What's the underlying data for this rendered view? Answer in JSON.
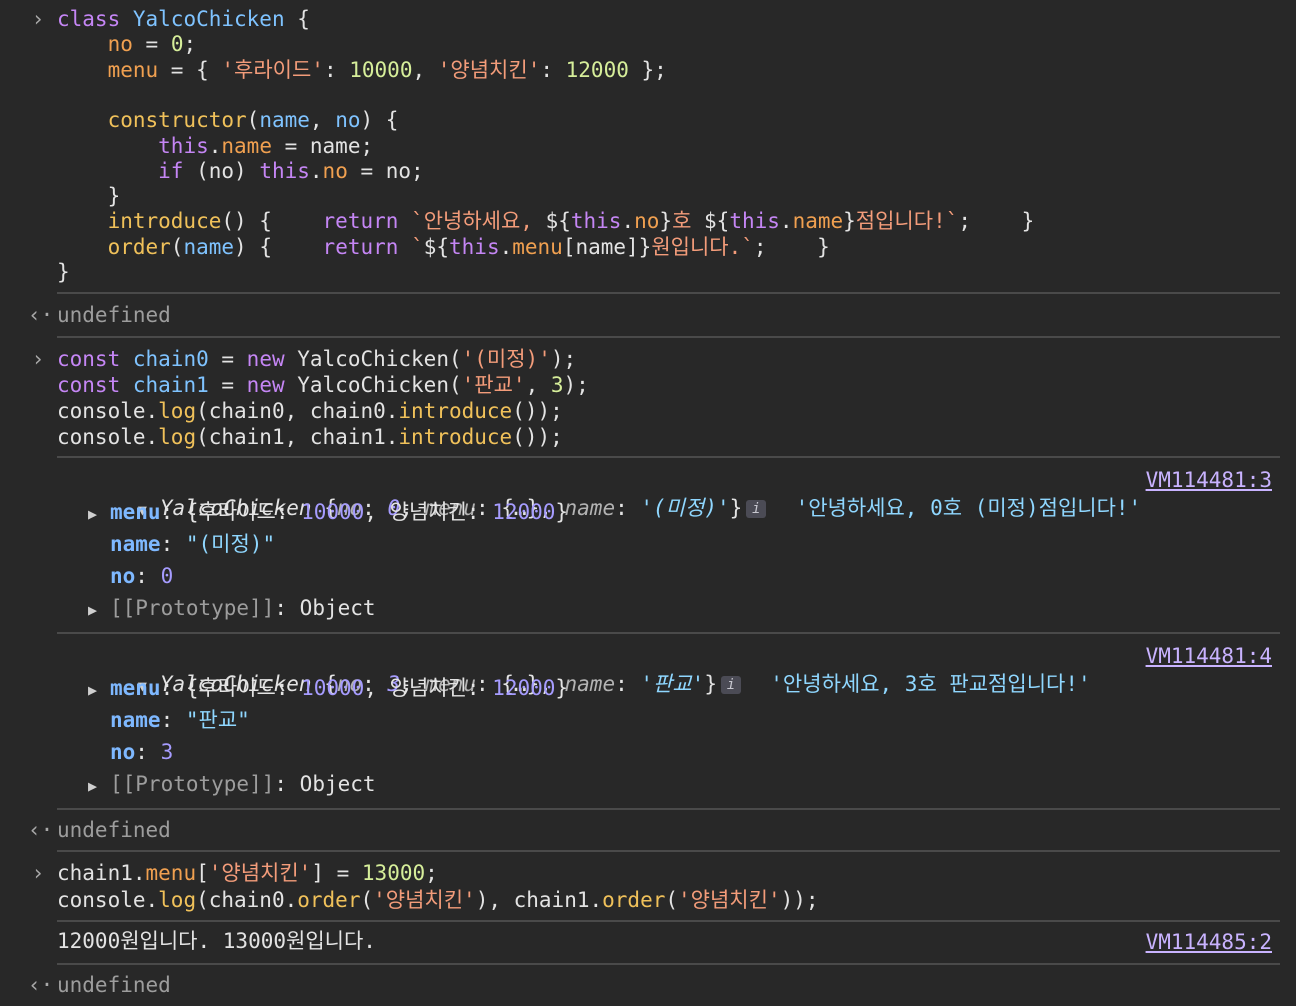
{
  "input1": {
    "lines": [
      [
        [
          "kw",
          "class"
        ],
        [
          "pl",
          " "
        ],
        [
          "cl",
          "YalcoChicken"
        ],
        [
          "pl",
          " {"
        ]
      ],
      [
        [
          "pl",
          "    "
        ],
        [
          "prm",
          "no"
        ],
        [
          "pl",
          " = "
        ],
        [
          "nm",
          "0"
        ],
        [
          "pl",
          ";"
        ]
      ],
      [
        [
          "pl",
          "    "
        ],
        [
          "prm",
          "menu"
        ],
        [
          "pl",
          " = { "
        ],
        [
          "st",
          "'후라이드'"
        ],
        [
          "pl",
          ": "
        ],
        [
          "nm",
          "10000"
        ],
        [
          "pl",
          ", "
        ],
        [
          "st",
          "'양념치킨'"
        ],
        [
          "pl",
          ": "
        ],
        [
          "nm",
          "12000"
        ],
        [
          "pl",
          " };"
        ]
      ],
      [
        [
          "pl",
          ""
        ]
      ],
      [
        [
          "pl",
          "    "
        ],
        [
          "fn",
          "constructor"
        ],
        [
          "pl",
          "("
        ],
        [
          "cl",
          "name"
        ],
        [
          "pl",
          ", "
        ],
        [
          "cl",
          "no"
        ],
        [
          "pl",
          ") {"
        ]
      ],
      [
        [
          "pl",
          "        "
        ],
        [
          "kw",
          "this"
        ],
        [
          "pl",
          "."
        ],
        [
          "prm",
          "name"
        ],
        [
          "pl",
          " = name;"
        ]
      ],
      [
        [
          "pl",
          "        "
        ],
        [
          "kw",
          "if"
        ],
        [
          "pl",
          " (no) "
        ],
        [
          "kw",
          "this"
        ],
        [
          "pl",
          "."
        ],
        [
          "prm",
          "no"
        ],
        [
          "pl",
          " = no;"
        ]
      ],
      [
        [
          "pl",
          "    }"
        ]
      ],
      [
        [
          "pl",
          "    "
        ],
        [
          "fn",
          "introduce"
        ],
        [
          "pl",
          "() {    "
        ],
        [
          "kw",
          "return"
        ],
        [
          "pl",
          " "
        ],
        [
          "st",
          "`안녕하세요, "
        ],
        [
          "pl",
          "${"
        ],
        [
          "kw",
          "this"
        ],
        [
          "pl",
          "."
        ],
        [
          "prm",
          "no"
        ],
        [
          "pl",
          "}"
        ],
        [
          "st",
          "호 "
        ],
        [
          "pl",
          "${"
        ],
        [
          "kw",
          "this"
        ],
        [
          "pl",
          "."
        ],
        [
          "prm",
          "name"
        ],
        [
          "pl",
          "}"
        ],
        [
          "st",
          "점입니다!`"
        ],
        [
          "pl",
          ";    }"
        ]
      ],
      [
        [
          "pl",
          "    "
        ],
        [
          "fn",
          "order"
        ],
        [
          "pl",
          "("
        ],
        [
          "cl",
          "name"
        ],
        [
          "pl",
          ") {    "
        ],
        [
          "kw",
          "return"
        ],
        [
          "pl",
          " "
        ],
        [
          "st",
          "`"
        ],
        [
          "pl",
          "${"
        ],
        [
          "kw",
          "this"
        ],
        [
          "pl",
          "."
        ],
        [
          "prm",
          "menu"
        ],
        [
          "pl",
          "[name]}"
        ],
        [
          "st",
          "원입니다.`"
        ],
        [
          "pl",
          ";    }"
        ]
      ],
      [
        [
          "pl",
          "}"
        ]
      ]
    ]
  },
  "result1": "undefined",
  "input2": {
    "lines": [
      [
        [
          "kw",
          "const"
        ],
        [
          "pl",
          " "
        ],
        [
          "cl",
          "chain0"
        ],
        [
          "pl",
          " = "
        ],
        [
          "kw",
          "new"
        ],
        [
          "pl",
          " YalcoChicken("
        ],
        [
          "st",
          "'(미정)'"
        ],
        [
          "pl",
          ");"
        ]
      ],
      [
        [
          "kw",
          "const"
        ],
        [
          "pl",
          " "
        ],
        [
          "cl",
          "chain1"
        ],
        [
          "pl",
          " = "
        ],
        [
          "kw",
          "new"
        ],
        [
          "pl",
          " YalcoChicken("
        ],
        [
          "st",
          "'판교'"
        ],
        [
          "pl",
          ", "
        ],
        [
          "nm",
          "3"
        ],
        [
          "pl",
          ");"
        ]
      ],
      [
        [
          "pl",
          "console."
        ],
        [
          "fn",
          "log"
        ],
        [
          "pl",
          "(chain0, chain0."
        ],
        [
          "fn",
          "introduce"
        ],
        [
          "pl",
          "());"
        ]
      ],
      [
        [
          "pl",
          "console."
        ],
        [
          "fn",
          "log"
        ],
        [
          "pl",
          "(chain1, chain1."
        ],
        [
          "fn",
          "introduce"
        ],
        [
          "pl",
          "());"
        ]
      ]
    ]
  },
  "log1": {
    "class_name": "YalcoChicken",
    "preview": [
      [
        "pl",
        " {"
      ],
      [
        "okey",
        "no"
      ],
      [
        "pl",
        ": "
      ],
      [
        "onum",
        "0"
      ],
      [
        "pl",
        ", "
      ],
      [
        "okey",
        "menu"
      ],
      [
        "pl",
        ": {…}, "
      ],
      [
        "okey",
        "name"
      ],
      [
        "pl",
        ": "
      ],
      [
        "ostr",
        "'(미정)'"
      ],
      [
        "pl",
        "}"
      ]
    ],
    "message": "'안녕하세요, 0호 (미정)점입니다!'",
    "source": "VM114481:3",
    "props": [
      {
        "key": "menu",
        "expandable": true,
        "value": [
          [
            "pl",
            "{"
          ],
          [
            "kor",
            "후라이드"
          ],
          [
            "pl",
            ": "
          ],
          [
            "pval-num",
            "10000"
          ],
          [
            "pl",
            ", "
          ],
          [
            "kor",
            "양념치킨"
          ],
          [
            "pl",
            ": "
          ],
          [
            "pval-num",
            "12000"
          ],
          [
            "pl",
            "}"
          ]
        ]
      },
      {
        "key": "name",
        "expandable": false,
        "value": [
          [
            "pval-str",
            "\"(미정)\""
          ]
        ]
      },
      {
        "key": "no",
        "expandable": false,
        "value": [
          [
            "pval-num",
            "0"
          ]
        ]
      },
      {
        "key": "[[Prototype]]",
        "expandable": true,
        "value": [
          [
            "pl",
            "Object"
          ]
        ]
      }
    ]
  },
  "log2": {
    "class_name": "YalcoChicken",
    "preview": [
      [
        "pl",
        " {"
      ],
      [
        "okey",
        "no"
      ],
      [
        "pl",
        ": "
      ],
      [
        "onum",
        "3"
      ],
      [
        "pl",
        ", "
      ],
      [
        "okey",
        "menu"
      ],
      [
        "pl",
        ": {…}, "
      ],
      [
        "okey",
        "name"
      ],
      [
        "pl",
        ": "
      ],
      [
        "ostr",
        "'판교'"
      ],
      [
        "pl",
        "}"
      ]
    ],
    "message": "'안녕하세요, 3호 판교점입니다!'",
    "source": "VM114481:4",
    "props": [
      {
        "key": "menu",
        "expandable": true,
        "value": [
          [
            "pl",
            "{"
          ],
          [
            "kor",
            "후라이드"
          ],
          [
            "pl",
            ": "
          ],
          [
            "pval-num",
            "10000"
          ],
          [
            "pl",
            ", "
          ],
          [
            "kor",
            "양념치킨"
          ],
          [
            "pl",
            ": "
          ],
          [
            "pval-num",
            "12000"
          ],
          [
            "pl",
            "}"
          ]
        ]
      },
      {
        "key": "name",
        "expandable": false,
        "value": [
          [
            "pval-str",
            "\"판교\""
          ]
        ]
      },
      {
        "key": "no",
        "expandable": false,
        "value": [
          [
            "pval-num",
            "3"
          ]
        ]
      },
      {
        "key": "[[Prototype]]",
        "expandable": true,
        "value": [
          [
            "pl",
            "Object"
          ]
        ]
      }
    ]
  },
  "result2": "undefined",
  "input3": {
    "lines": [
      [
        [
          "pl",
          "chain1."
        ],
        [
          "prm",
          "menu"
        ],
        [
          "pl",
          "["
        ],
        [
          "st",
          "'양념치킨'"
        ],
        [
          "pl",
          "] = "
        ],
        [
          "nm",
          "13000"
        ],
        [
          "pl",
          ";"
        ]
      ],
      [
        [
          "pl",
          "console."
        ],
        [
          "fn",
          "log"
        ],
        [
          "pl",
          "(chain0."
        ],
        [
          "fn",
          "order"
        ],
        [
          "pl",
          "("
        ],
        [
          "st",
          "'양념치킨'"
        ],
        [
          "pl",
          "), chain1."
        ],
        [
          "fn",
          "order"
        ],
        [
          "pl",
          "("
        ],
        [
          "st",
          "'양념치킨'"
        ],
        [
          "pl",
          "));"
        ]
      ]
    ]
  },
  "log3": {
    "message": "12000원입니다. 13000원입니다.",
    "source": "VM114485:2"
  },
  "result3": "undefined",
  "glyphs": {
    "input_prompt": "›",
    "result_prompt": "‹·",
    "expanded": "▼",
    "collapsed": "▶",
    "info": "i"
  }
}
